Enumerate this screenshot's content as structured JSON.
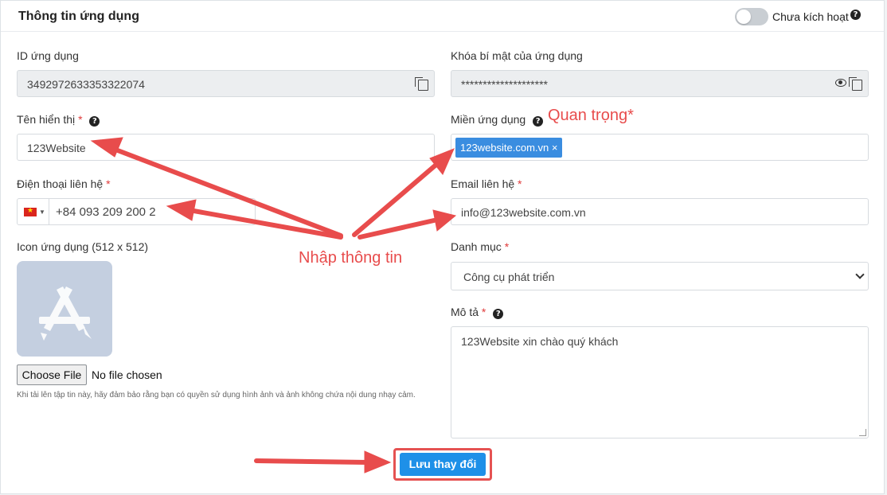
{
  "header": {
    "title": "Thông tin ứng dụng",
    "status_label": "Chưa kích hoạt"
  },
  "fields": {
    "app_id": {
      "label": "ID ứng dụng",
      "value": "3492972633353322074"
    },
    "app_secret": {
      "label": "Khóa bí mật của ứng dụng",
      "value": "********************"
    },
    "display_name": {
      "label": "Tên hiển thị",
      "required": "*",
      "value": "123Website"
    },
    "app_domain": {
      "label": "Miền ứng dụng",
      "tag": "123website.com.vn ×"
    },
    "phone": {
      "label": "Điện thoại liên hệ",
      "required": "*",
      "value": "+84 093 209 200 2"
    },
    "email": {
      "label": "Email liên hệ",
      "required": "*",
      "value": "info@123website.com.vn"
    },
    "icon": {
      "label": "Icon ứng dụng (512 x 512)",
      "choose_button": "Choose File",
      "file_status": "No file chosen",
      "hint": "Khi tải lên tập tin này, hãy đảm bảo rằng bạn có quyền sử dụng hình ảnh và ảnh không chứa nội dung nhạy cảm."
    },
    "category": {
      "label": "Danh mục",
      "required": "*",
      "selected": "Công cụ phát triển"
    },
    "description": {
      "label": "Mô tả",
      "required": "*",
      "value": "123Website xin chào quý khách"
    }
  },
  "save_button": "Lưu thay đổi",
  "annotations": {
    "important": "Quan trọng*",
    "enter_info": "Nhập thông tin"
  },
  "colors": {
    "accent": "#1e90e8",
    "annotation": "#e84c4c",
    "tag": "#3a8de0"
  }
}
